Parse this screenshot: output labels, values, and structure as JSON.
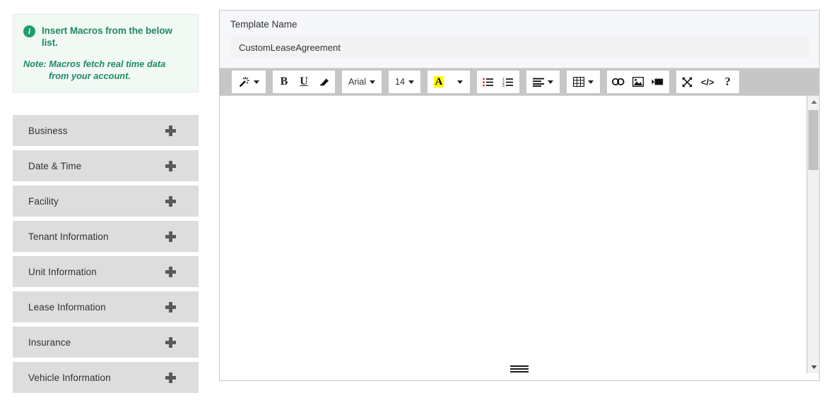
{
  "sidebar": {
    "info": {
      "icon": "info-circle-icon",
      "title": "Insert Macros from the below list.",
      "note_label": "Note:",
      "note_line1": "Macros fetch real time data",
      "note_line2": "from your account.",
      "accent_color": "#1e8a63",
      "background_color": "#f2f9f5"
    },
    "macro_groups": [
      {
        "label": "Business",
        "expander": "plus-icon"
      },
      {
        "label": "Date & Time",
        "expander": "plus-icon"
      },
      {
        "label": "Facility",
        "expander": "plus-icon"
      },
      {
        "label": "Tenant Information",
        "expander": "plus-icon"
      },
      {
        "label": "Unit Information",
        "expander": "plus-icon"
      },
      {
        "label": "Lease Information",
        "expander": "plus-icon"
      },
      {
        "label": "Insurance",
        "expander": "plus-icon"
      },
      {
        "label": "Vehicle Information",
        "expander": "plus-icon"
      }
    ]
  },
  "panel": {
    "template_name_label": "Template Name",
    "template_name_value": "CustomLeaseAgreement",
    "template_name_placeholder": "Template Name"
  },
  "toolbar": {
    "groups": [
      {
        "name": "macro-group",
        "buttons": [
          {
            "name": "insert-macro-button",
            "icon": "magic-wand-icon",
            "label": "",
            "caret": true
          }
        ]
      },
      {
        "name": "format-group",
        "buttons": [
          {
            "name": "bold-button",
            "icon": "bold-icon",
            "label": "B",
            "caret": false
          },
          {
            "name": "underline-button",
            "icon": "underline-icon",
            "label": "U",
            "caret": false
          },
          {
            "name": "clear-formatting-button",
            "icon": "eraser-icon",
            "label": "",
            "caret": false
          }
        ]
      },
      {
        "name": "font-family-group",
        "buttons": [
          {
            "name": "font-family-select",
            "icon": "font-family-icon",
            "label": "Arial",
            "caret": true
          }
        ]
      },
      {
        "name": "font-size-group",
        "buttons": [
          {
            "name": "font-size-select",
            "icon": "font-size-icon",
            "label": "14",
            "caret": true
          }
        ]
      },
      {
        "name": "color-group",
        "buttons": [
          {
            "name": "text-color-button",
            "icon": "text-color-icon",
            "label": "A",
            "caret": true
          }
        ]
      },
      {
        "name": "list-group",
        "buttons": [
          {
            "name": "unordered-list-button",
            "icon": "bullet-list-icon",
            "label": "",
            "caret": false
          },
          {
            "name": "ordered-list-button",
            "icon": "numbered-list-icon",
            "label": "",
            "caret": false
          }
        ]
      },
      {
        "name": "align-group",
        "buttons": [
          {
            "name": "align-button",
            "icon": "align-left-icon",
            "label": "",
            "caret": true
          }
        ]
      },
      {
        "name": "table-group",
        "buttons": [
          {
            "name": "insert-table-button",
            "icon": "table-icon",
            "label": "",
            "caret": true
          }
        ]
      },
      {
        "name": "insert-group",
        "buttons": [
          {
            "name": "insert-link-button",
            "icon": "link-icon",
            "label": "",
            "caret": false
          },
          {
            "name": "insert-image-button",
            "icon": "image-icon",
            "label": "",
            "caret": false
          },
          {
            "name": "insert-video-button",
            "icon": "video-icon",
            "label": "",
            "caret": false
          }
        ]
      },
      {
        "name": "tools-group",
        "buttons": [
          {
            "name": "fullscreen-button",
            "icon": "fullscreen-icon",
            "label": "",
            "caret": false
          },
          {
            "name": "source-code-button",
            "icon": "code-icon",
            "label": "</>",
            "caret": false
          },
          {
            "name": "help-button",
            "icon": "question-mark-icon",
            "label": "?",
            "caret": false
          }
        ]
      }
    ],
    "highlight_color": "#ffff00",
    "background_color": "#c6c6c6"
  },
  "editor": {
    "content": "",
    "placeholder": "",
    "resize_handle": "resize-grip-icon"
  },
  "scrollbar": {
    "up_arrow": "scroll-up-arrow-icon",
    "down_arrow": "scroll-down-arrow-icon",
    "thumb": "scrollbar-thumb"
  }
}
